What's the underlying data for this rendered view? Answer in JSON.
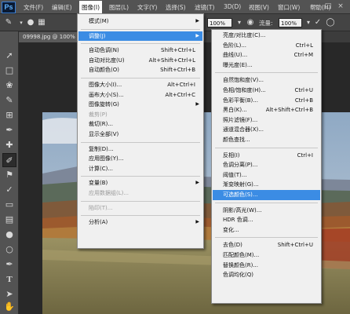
{
  "app": {
    "logo": "Ps"
  },
  "menubar": {
    "items": [
      "文件(F)",
      "编辑(E)",
      "图像(I)",
      "图层(L)",
      "文字(Y)",
      "选择(S)",
      "滤镜(T)",
      "3D(D)",
      "视图(V)",
      "窗口(W)",
      "帮助(H)"
    ],
    "active": "图像(I)"
  },
  "window_controls": {
    "minimize": "–",
    "restore": "□",
    "close": "×"
  },
  "options": {
    "zoom1": "100%",
    "flow_label": "流量:",
    "flow": "100%"
  },
  "document": {
    "tab": "09998.jpg @ 100%"
  },
  "image_menu": {
    "items": [
      {
        "label": "模式(M)",
        "submenu": true
      },
      {
        "separator": true
      },
      {
        "label": "调整(J)",
        "submenu": true,
        "highlighted": true
      },
      {
        "separator": true
      },
      {
        "label": "自动色调(N)",
        "shortcut": "Shift+Ctrl+L"
      },
      {
        "label": "自动对比度(U)",
        "shortcut": "Alt+Shift+Ctrl+L"
      },
      {
        "label": "自动颜色(O)",
        "shortcut": "Shift+Ctrl+B"
      },
      {
        "separator": true
      },
      {
        "label": "图像大小(I)...",
        "shortcut": "Alt+Ctrl+I"
      },
      {
        "label": "画布大小(S)...",
        "shortcut": "Alt+Ctrl+C"
      },
      {
        "label": "图像旋转(G)",
        "submenu": true
      },
      {
        "label": "裁剪(P)",
        "disabled": true
      },
      {
        "label": "裁切(R)..."
      },
      {
        "label": "显示全部(V)"
      },
      {
        "separator": true
      },
      {
        "label": "复制(D)..."
      },
      {
        "label": "应用图像(Y)..."
      },
      {
        "label": "计算(C)..."
      },
      {
        "separator": true
      },
      {
        "label": "变量(B)",
        "submenu": true
      },
      {
        "label": "应用数据组(L)...",
        "disabled": true
      },
      {
        "separator": true
      },
      {
        "label": "陷印(T)...",
        "disabled": true
      },
      {
        "separator": true
      },
      {
        "label": "分析(A)",
        "submenu": true
      }
    ]
  },
  "adjust_menu": {
    "items": [
      {
        "label": "亮度/对比度(C)..."
      },
      {
        "label": "色阶(L)...",
        "shortcut": "Ctrl+L"
      },
      {
        "label": "曲线(U)...",
        "shortcut": "Ctrl+M"
      },
      {
        "label": "曝光度(E)..."
      },
      {
        "separator": true
      },
      {
        "label": "自然饱和度(V)..."
      },
      {
        "label": "色相/饱和度(H)...",
        "shortcut": "Ctrl+U"
      },
      {
        "label": "色彩平衡(B)...",
        "shortcut": "Ctrl+B"
      },
      {
        "label": "黑白(K)...",
        "shortcut": "Alt+Shift+Ctrl+B"
      },
      {
        "label": "照片滤镜(F)..."
      },
      {
        "label": "通道混合器(X)..."
      },
      {
        "label": "颜色查找..."
      },
      {
        "separator": true
      },
      {
        "label": "反相(I)",
        "shortcut": "Ctrl+I"
      },
      {
        "label": "色调分离(P)..."
      },
      {
        "label": "阈值(T)..."
      },
      {
        "label": "渐变映射(G)..."
      },
      {
        "label": "可选颜色(S)...",
        "highlighted": true
      },
      {
        "separator": true
      },
      {
        "label": "阴影/高光(W)..."
      },
      {
        "label": "HDR 色调..."
      },
      {
        "label": "变化..."
      },
      {
        "separator": true
      },
      {
        "label": "去色(D)",
        "shortcut": "Shift+Ctrl+U"
      },
      {
        "label": "匹配颜色(M)..."
      },
      {
        "label": "替换颜色(R)..."
      },
      {
        "label": "色调均化(Q)"
      }
    ]
  },
  "colors": {
    "highlight": "#3b8ce4",
    "menu_bg": "#f0f0f0",
    "chrome": "#535353"
  }
}
